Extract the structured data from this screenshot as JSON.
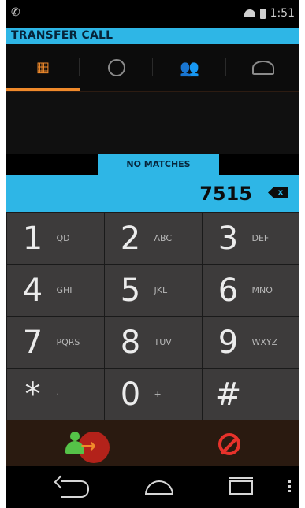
{
  "status": {
    "time": "1:51",
    "left_icon": "phone-notification-icon",
    "wifi_icon": "wifi-icon",
    "battery_icon": "battery-icon"
  },
  "header": {
    "title": "TRANSFER CALL"
  },
  "tabs": [
    {
      "icon": "dialpad-icon",
      "active": true
    },
    {
      "icon": "clock-icon",
      "active": false
    },
    {
      "icon": "contacts-group-icon",
      "active": false
    },
    {
      "icon": "address-book-icon",
      "active": false
    }
  ],
  "results": {
    "no_matches": "NO MATCHES"
  },
  "entry": {
    "number": "7515",
    "backspace_label": "x",
    "backspace_icon": "backspace-icon"
  },
  "keypad": [
    {
      "digit": "1",
      "sub": "QD"
    },
    {
      "digit": "2",
      "sub": "ABC"
    },
    {
      "digit": "3",
      "sub": "DEF"
    },
    {
      "digit": "4",
      "sub": "GHI"
    },
    {
      "digit": "5",
      "sub": "JKL"
    },
    {
      "digit": "6",
      "sub": "MNO"
    },
    {
      "digit": "7",
      "sub": "PQRS"
    },
    {
      "digit": "8",
      "sub": "TUV"
    },
    {
      "digit": "9",
      "sub": "WXYZ"
    },
    {
      "digit": "*",
      "sub": "·"
    },
    {
      "digit": "0",
      "sub": "+"
    },
    {
      "digit": "#",
      "sub": ""
    }
  ],
  "actions": {
    "transfer_icon": "transfer-call-icon",
    "cancel_icon": "cancel-icon"
  },
  "nav": {
    "back_icon": "back-icon",
    "home_icon": "home-icon",
    "recent_icon": "recent-apps-icon",
    "menu_icon": "menu-icon"
  },
  "colors": {
    "accent_blue": "#2eb6e6",
    "accent_orange": "#f08a2b",
    "key_bg": "#3d3b3b",
    "cancel_red": "#e7322b"
  }
}
